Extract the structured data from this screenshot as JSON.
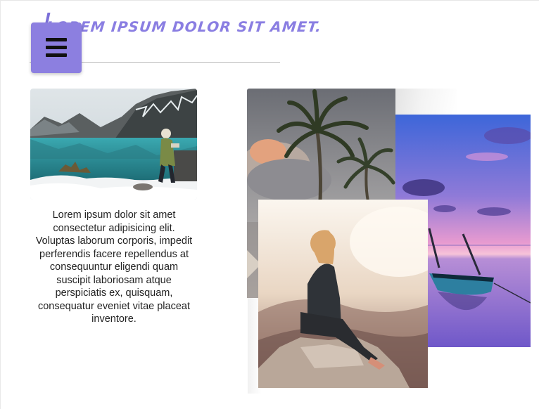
{
  "header": {
    "title": "LOREM IPSUM DOLOR SIT AMET."
  },
  "menu": {
    "icon": "hamburger-menu-icon"
  },
  "card": {
    "text": "Lorem ipsum dolor sit amet consectetur adipisicing elit. Voluptas laborum corporis, impedit perferendis facere repellendus at consequuntur eligendi quam suscipit laboriosam atque perspiciatis ex, quisquam, consequatur eveniet vitae placeat inventore."
  },
  "colors": {
    "accent": "#8c7fe0",
    "title": "#8a7ee2",
    "rule": "#b8b8b8",
    "text": "#222222"
  }
}
